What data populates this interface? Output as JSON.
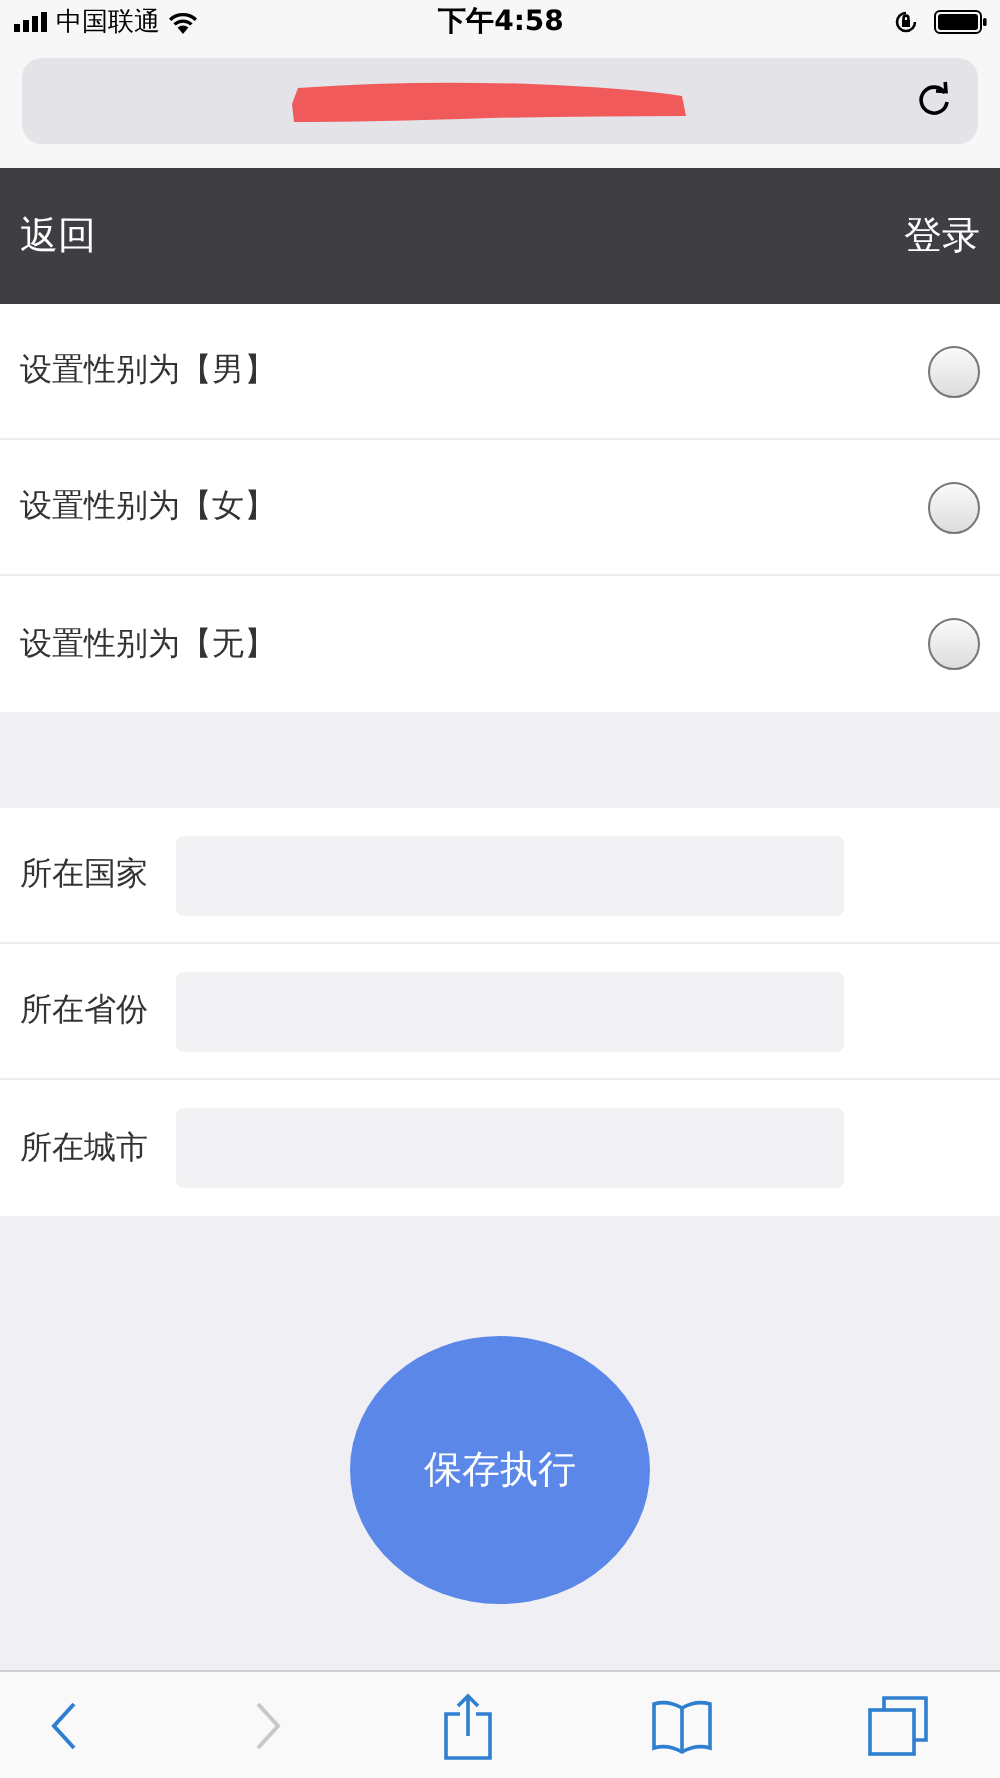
{
  "status_bar": {
    "carrier": "中国联通",
    "time": "下午4:58"
  },
  "nav": {
    "back": "返回",
    "login": "登录"
  },
  "gender_options": [
    {
      "label": "设置性别为【男】",
      "selected": false
    },
    {
      "label": "设置性别为【女】",
      "selected": false
    },
    {
      "label": "设置性别为【无】",
      "selected": false
    }
  ],
  "fields": [
    {
      "label": "所在国家"
    },
    {
      "label": "所在省份"
    },
    {
      "label": "所在城市"
    }
  ],
  "save_button": "保存执行",
  "toolbar": {
    "back_disabled": false,
    "forward_disabled": true
  }
}
